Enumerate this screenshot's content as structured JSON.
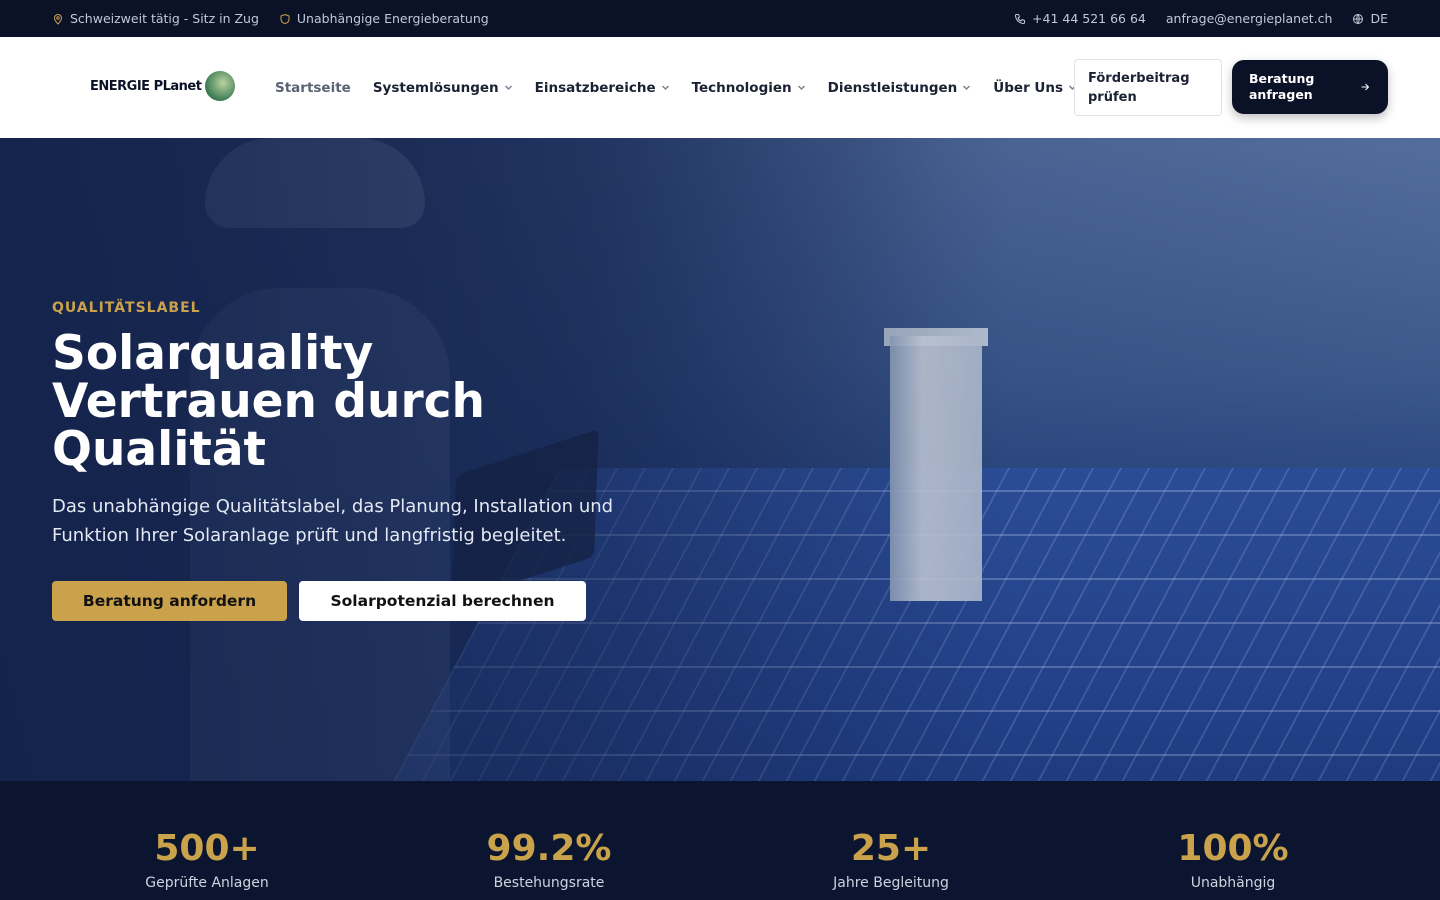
{
  "topbar": {
    "location": "Schweizweit tätig - Sitz in Zug",
    "consulting": "Unabhängige Energieberatung",
    "phone": "+41 44 521 66 64",
    "email": "anfrage@energieplanet.ch",
    "language": "DE"
  },
  "header": {
    "logo_text": "ENERGIE PLanet",
    "nav": [
      {
        "label": "Startseite"
      },
      {
        "label": "Systemlösungen"
      },
      {
        "label": "Einsatzbereiche"
      },
      {
        "label": "Technologien"
      },
      {
        "label": "Dienstleistungen"
      },
      {
        "label": "Über Uns"
      }
    ],
    "foerder_button": "Förderbeitrag prüfen",
    "beratung_button": "Beratung anfragen"
  },
  "hero": {
    "eyebrow": "QUALITÄTSLABEL",
    "title_line1": "Solarquality",
    "title_line2": "Vertrauen durch",
    "title_line3": "Qualität",
    "lead": "Das unabhängige Qualitätslabel, das Planung, Installation und Funktion Ihrer Solaranlage prüft und langfristig begleitet.",
    "cta_primary": "Beratung anfordern",
    "cta_secondary": "Solarpotenzial berechnen"
  },
  "stats": [
    {
      "value": "500+",
      "label": "Geprüfte Anlagen"
    },
    {
      "value": "99.2%",
      "label": "Bestehungsrate"
    },
    {
      "value": "25+",
      "label": "Jahre Begleitung"
    },
    {
      "value": "100%",
      "label": "Unabhängig"
    }
  ],
  "colors": {
    "accent": "#c9a24b",
    "dark": "#0b1228",
    "stats_bg": "#0b1530"
  }
}
